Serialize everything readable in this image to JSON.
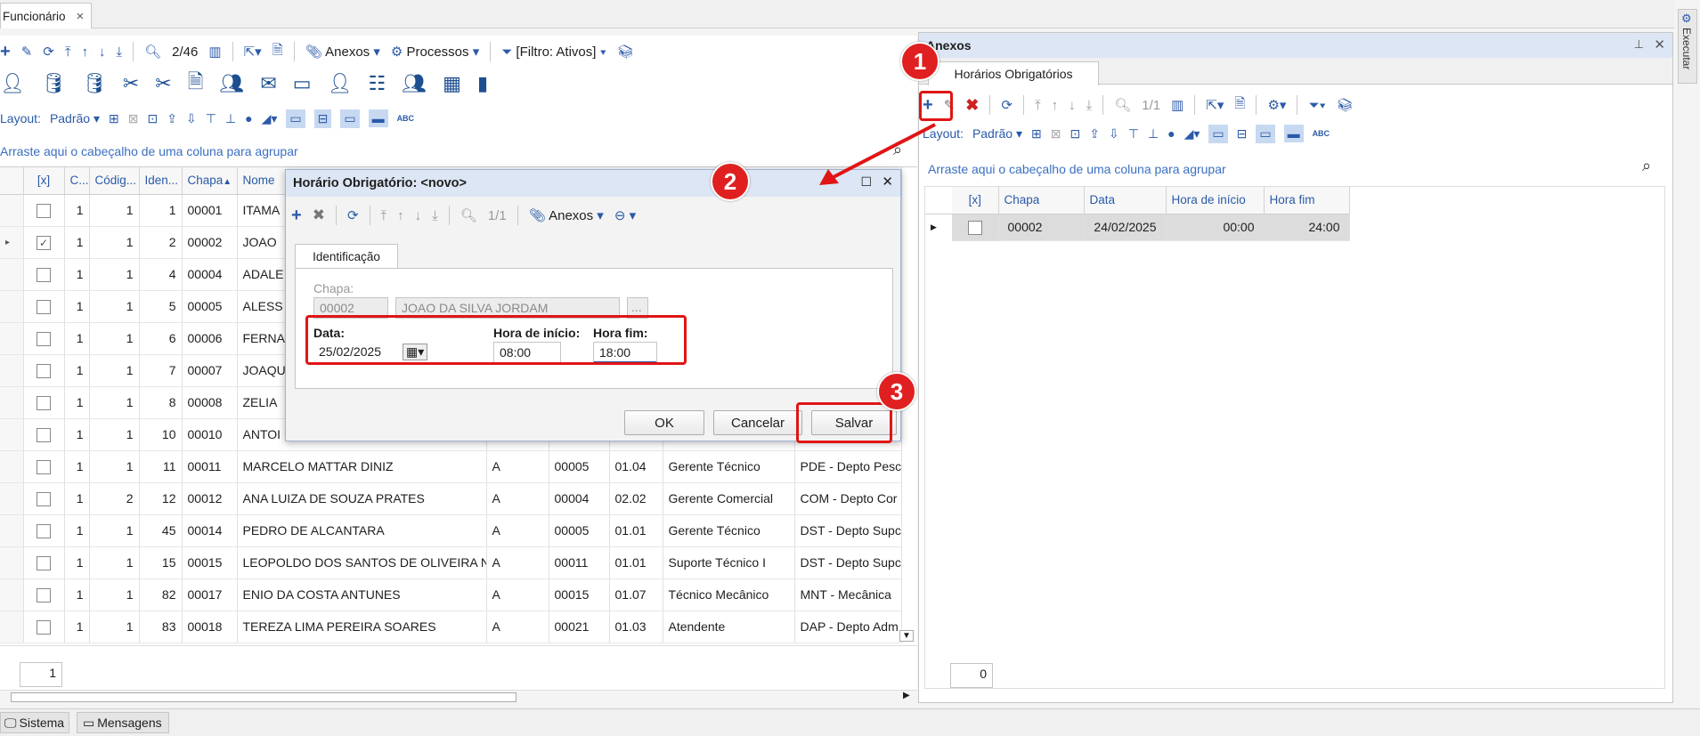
{
  "tab": {
    "label": "Funcionário",
    "close": "×"
  },
  "main_toolbar": {
    "counter": "2/46",
    "anexos": "Anexos",
    "processos": "Processos",
    "filtro": "[Filtro: Ativos]"
  },
  "layout_bar": {
    "layout_label": "Layout:",
    "layout_value": "Padrão",
    "abc": "ABC"
  },
  "group_hint": "Arraste aqui o cabeçalho de uma coluna para agrupar",
  "grid": {
    "headers": [
      "[x]",
      "C...",
      "Códig...",
      "Iden...",
      "Chapa",
      "Nome"
    ],
    "rows": [
      {
        "c": "1",
        "cod": "1",
        "id": "1",
        "chapa": "00001",
        "nome": "ITAMA",
        "sit": "",
        "f": "",
        "s": "",
        "func": "",
        "dep": ""
      },
      {
        "c": "1",
        "cod": "1",
        "id": "2",
        "chapa": "00002",
        "nome": "JOAO",
        "sit": "",
        "f": "",
        "s": "",
        "func": "",
        "dep": ""
      },
      {
        "c": "1",
        "cod": "1",
        "id": "4",
        "chapa": "00004",
        "nome": "ADALE",
        "sit": "",
        "f": "",
        "s": "",
        "func": "",
        "dep": ""
      },
      {
        "c": "1",
        "cod": "1",
        "id": "5",
        "chapa": "00005",
        "nome": "ALESS",
        "sit": "",
        "f": "",
        "s": "",
        "func": "",
        "dep": ""
      },
      {
        "c": "1",
        "cod": "1",
        "id": "6",
        "chapa": "00006",
        "nome": "FERNA",
        "sit": "",
        "f": "",
        "s": "",
        "func": "",
        "dep": ""
      },
      {
        "c": "1",
        "cod": "1",
        "id": "7",
        "chapa": "00007",
        "nome": "JOAQU",
        "sit": "",
        "f": "",
        "s": "",
        "func": "",
        "dep": ""
      },
      {
        "c": "1",
        "cod": "1",
        "id": "8",
        "chapa": "00008",
        "nome": "ZELIA",
        "sit": "",
        "f": "",
        "s": "",
        "func": "",
        "dep": ""
      },
      {
        "c": "1",
        "cod": "1",
        "id": "10",
        "chapa": "00010",
        "nome": "ANTOI",
        "sit": "",
        "f": "",
        "s": "",
        "func": "",
        "dep": ""
      },
      {
        "c": "1",
        "cod": "1",
        "id": "11",
        "chapa": "00011",
        "nome": "MARCELO MATTAR DINIZ",
        "sit": "A",
        "f": "00005",
        "s": "01.04",
        "func": "Gerente Técnico",
        "dep": "PDE - Depto Pesc"
      },
      {
        "c": "1",
        "cod": "2",
        "id": "12",
        "chapa": "00012",
        "nome": "ANA LUIZA  DE SOUZA PRATES",
        "sit": "A",
        "f": "00004",
        "s": "02.02",
        "func": "Gerente Comercial",
        "dep": "COM - Depto Cor"
      },
      {
        "c": "1",
        "cod": "1",
        "id": "45",
        "chapa": "00014",
        "nome": "PEDRO DE ALCANTARA",
        "sit": "A",
        "f": "00005",
        "s": "01.01",
        "func": "Gerente Técnico",
        "dep": "DST - Depto Supc"
      },
      {
        "c": "1",
        "cod": "1",
        "id": "15",
        "chapa": "00015",
        "nome": "LEOPOLDO DOS SANTOS DE OLIVEIRA N...",
        "sit": "A",
        "f": "00011",
        "s": "01.01",
        "func": "Suporte Técnico I",
        "dep": "DST - Depto Supc"
      },
      {
        "c": "1",
        "cod": "1",
        "id": "82",
        "chapa": "00017",
        "nome": "ENIO DA COSTA ANTUNES",
        "sit": "A",
        "f": "00015",
        "s": "01.07",
        "func": "Técnico Mecânico",
        "dep": "MNT - Mecânica"
      },
      {
        "c": "1",
        "cod": "1",
        "id": "83",
        "chapa": "00018",
        "nome": "TEREZA LIMA PEREIRA SOARES",
        "sit": "A",
        "f": "00021",
        "s": "01.03",
        "func": "Atendente",
        "dep": "DAP - Depto Adm"
      }
    ],
    "footer_count": "1"
  },
  "dialog": {
    "title": "Horário Obrigatório: <novo>",
    "counter": "1/1",
    "anexos": "Anexos",
    "tab": "Identificação",
    "chapa_label": "Chapa:",
    "chapa_value": "00002",
    "nome_value": "JOAO DA SILVA JORDAM",
    "ellipsis": "...",
    "data_label": "Data:",
    "data_value": "25/02/2025",
    "hora_inicio_label": "Hora de início:",
    "hora_inicio_value": "08:00",
    "hora_fim_label": "Hora fim:",
    "hora_fim_value": "18:00",
    "ok": "OK",
    "cancelar": "Cancelar",
    "salvar": "Salvar"
  },
  "anexos_panel": {
    "title": "Anexos",
    "tab": "Horários Obrigatórios",
    "counter": "1/1",
    "layout_label": "Layout:",
    "layout_value": "Padrão",
    "abc": "ABC",
    "group_hint": "Arraste aqui o cabeçalho de uma coluna para agrupar",
    "headers": [
      "[x]",
      "Chapa",
      "Data",
      "Hora de início",
      "Hora fim"
    ],
    "row": {
      "chapa": "00002",
      "data": "24/02/2025",
      "inicio": "00:00",
      "fim": "24:00"
    },
    "footer_count": "0"
  },
  "side_executar": "Executar",
  "status_bar": {
    "sistema": "Sistema",
    "mensagens": "Mensagens"
  },
  "badges": [
    "1",
    "2",
    "3"
  ],
  "colors": {
    "accent": "#2a5aa8",
    "highlight": "#e01515",
    "header_bg": "#dde6f4"
  }
}
